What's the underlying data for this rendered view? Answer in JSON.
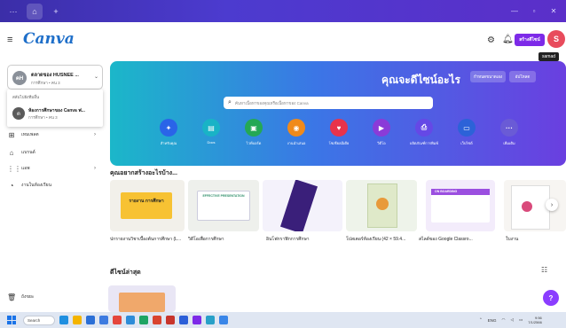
{
  "header": {
    "logo": "Canva",
    "create_label": "สร้างดีไซน์",
    "avatar_initial": "S",
    "tooltip": "samad"
  },
  "account": {
    "initials": "คH",
    "name": "ตลาดของ HUSNEE ...",
    "sub": "การศึกษา • คน 3",
    "dropdown_label": "สลับไปยังทีมอื่น",
    "team_initial": "ต",
    "team_name": "ห้องการศึกษาของ Canva ฟ...",
    "team_sub": "การศึกษา • คน 3"
  },
  "sidebar": {
    "items": [
      {
        "label": "เทมเพลต",
        "icon": "template-icon",
        "has_chevron": true
      },
      {
        "label": "แบรนด์",
        "icon": "brand-icon",
        "has_chevron": false
      },
      {
        "label": "แอพ",
        "icon": "apps-icon",
        "has_chevron": true
      },
      {
        "label": "งานในห้องเรียน",
        "icon": "classwork-icon",
        "has_chevron": false
      }
    ],
    "trash_label": "ถังขยะ"
  },
  "hero": {
    "title": "คุณจะดีไซน์อะไร",
    "btn_custom_size": "กำหนดขนาดเอง",
    "btn_upload": "อัปโหลด",
    "search_placeholder": "ค้นหาเนื้อหาของคุณหรือเนื้อหาของ Canva",
    "categories": [
      {
        "label": "สำหรับคุณ",
        "color": "#2a64e8",
        "icon": "sparkle-icon"
      },
      {
        "label": "Docs",
        "color": "#19b3c6",
        "icon": "docs-icon"
      },
      {
        "label": "ไวท์บอร์ด",
        "color": "#24a855",
        "icon": "whiteboard-icon"
      },
      {
        "label": "งานนำเสนอ",
        "color": "#f08a1a",
        "icon": "presentation-icon"
      },
      {
        "label": "โซเชียลมีเดีย",
        "color": "#e8334b",
        "icon": "social-icon"
      },
      {
        "label": "วิดีโอ",
        "color": "#8a3bd8",
        "icon": "video-icon"
      },
      {
        "label": "ผลิตภัณฑ์การพิมพ์",
        "color": "#6548e6",
        "icon": "print-icon"
      },
      {
        "label": "เว็บไซต์",
        "color": "#2c62d8",
        "icon": "website-icon"
      },
      {
        "label": "เพิ่มเติม",
        "color": "#6a5bd6",
        "icon": "more-icon"
      }
    ]
  },
  "templates": {
    "section_title": "คุณอยากสร้างอะไรบ้าง...",
    "items": [
      {
        "label": "ปกรายงานวิชาเบื้องต้นการศึกษา (L...",
        "thumb_text": "รายงาน การศึกษา",
        "bg": "#f2f0ea",
        "accent": "#f7c233"
      },
      {
        "label": "วิดีโอเพื่อการศึกษา",
        "thumb_text": "EFFECTIVE PRESENTATION",
        "bg": "#eef0ec",
        "accent": "#2f8f6a"
      },
      {
        "label": "อินโฟกราฟิกการศึกษา",
        "thumb_text": "",
        "bg": "#f4f2fb",
        "accent": "#3a1f7a"
      },
      {
        "label": "โปสเตอร์ห้องเรียน (42 × 59.4...",
        "thumb_text": "",
        "bg": "#eef3ea",
        "accent": "#e89a3a"
      },
      {
        "label": "สไลด์ของ Google Classro...",
        "thumb_text": "ON BOARDING",
        "bg": "#f3ecfb",
        "accent": "#9b4fe0"
      },
      {
        "label": "ใบงาน",
        "thumb_text": "",
        "bg": "#f7f5f2",
        "accent": "#d94a7b"
      }
    ]
  },
  "recent": {
    "section_title": "ดีไซน์ล่าสุด"
  },
  "taskbar": {
    "search_label": "Search",
    "lang": "ENG",
    "time": "9:56",
    "date": "7/1/2566"
  }
}
